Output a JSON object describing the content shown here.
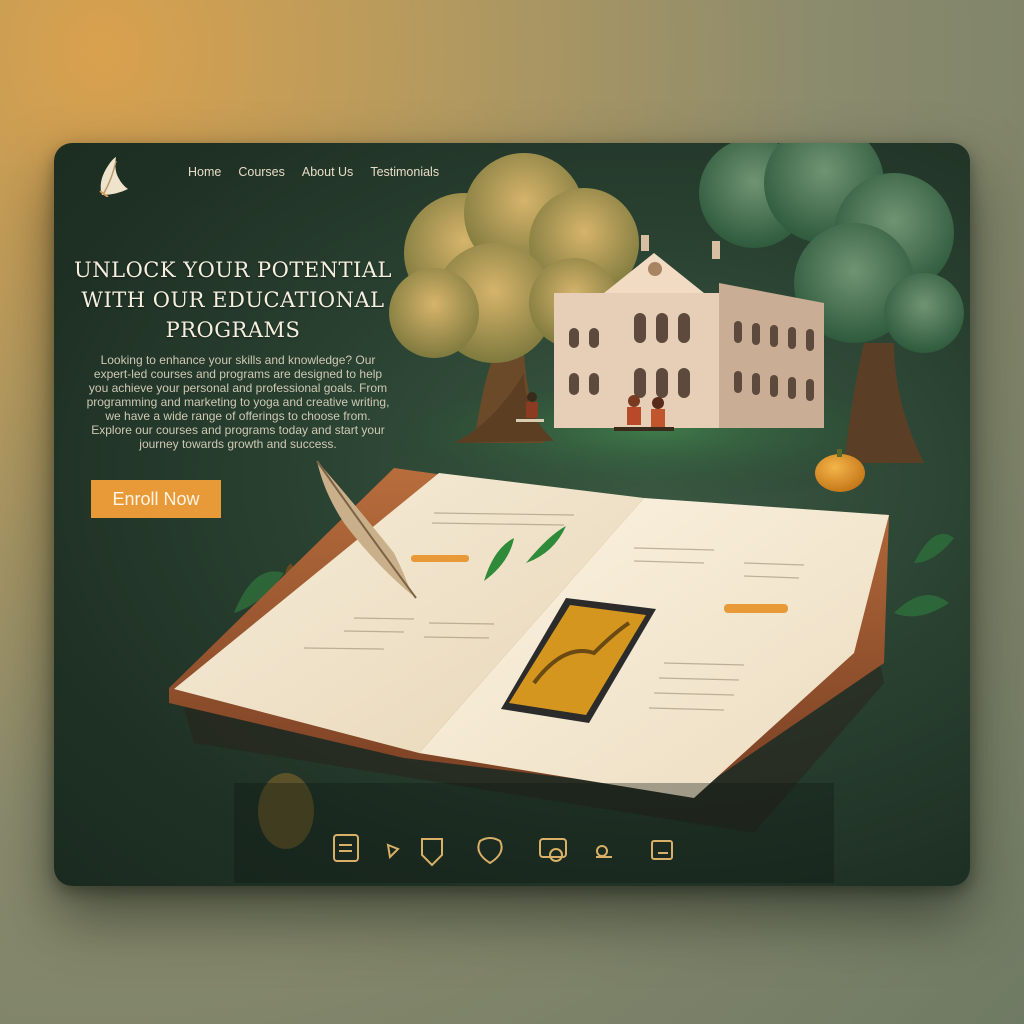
{
  "nav": {
    "items": [
      "Home",
      "Courses",
      "About Us",
      "Testimonials"
    ]
  },
  "hero": {
    "title": "UNLOCK YOUR POTENTIAL WITH OUR EDUCATIONAL PROGRAMS",
    "description": "Looking to enhance your skills and knowledge? Our expert-led courses and programs are designed to help you achieve your personal and professional goals. From programming and marketing to yoga and creative writing, we have a wide range of offerings to choose from. Explore our courses and programs today and start your journey towards growth and success.",
    "cta_label": "Enroll Now"
  },
  "colors": {
    "accent": "#e99a38",
    "panel": "#1f3125",
    "text_light": "#f6efde"
  },
  "icons": [
    "feather-logo-icon",
    "book-icon",
    "pencil-icon",
    "badge-icon",
    "heart-icon",
    "devices-icon",
    "glasses-icon",
    "certificate-icon"
  ]
}
